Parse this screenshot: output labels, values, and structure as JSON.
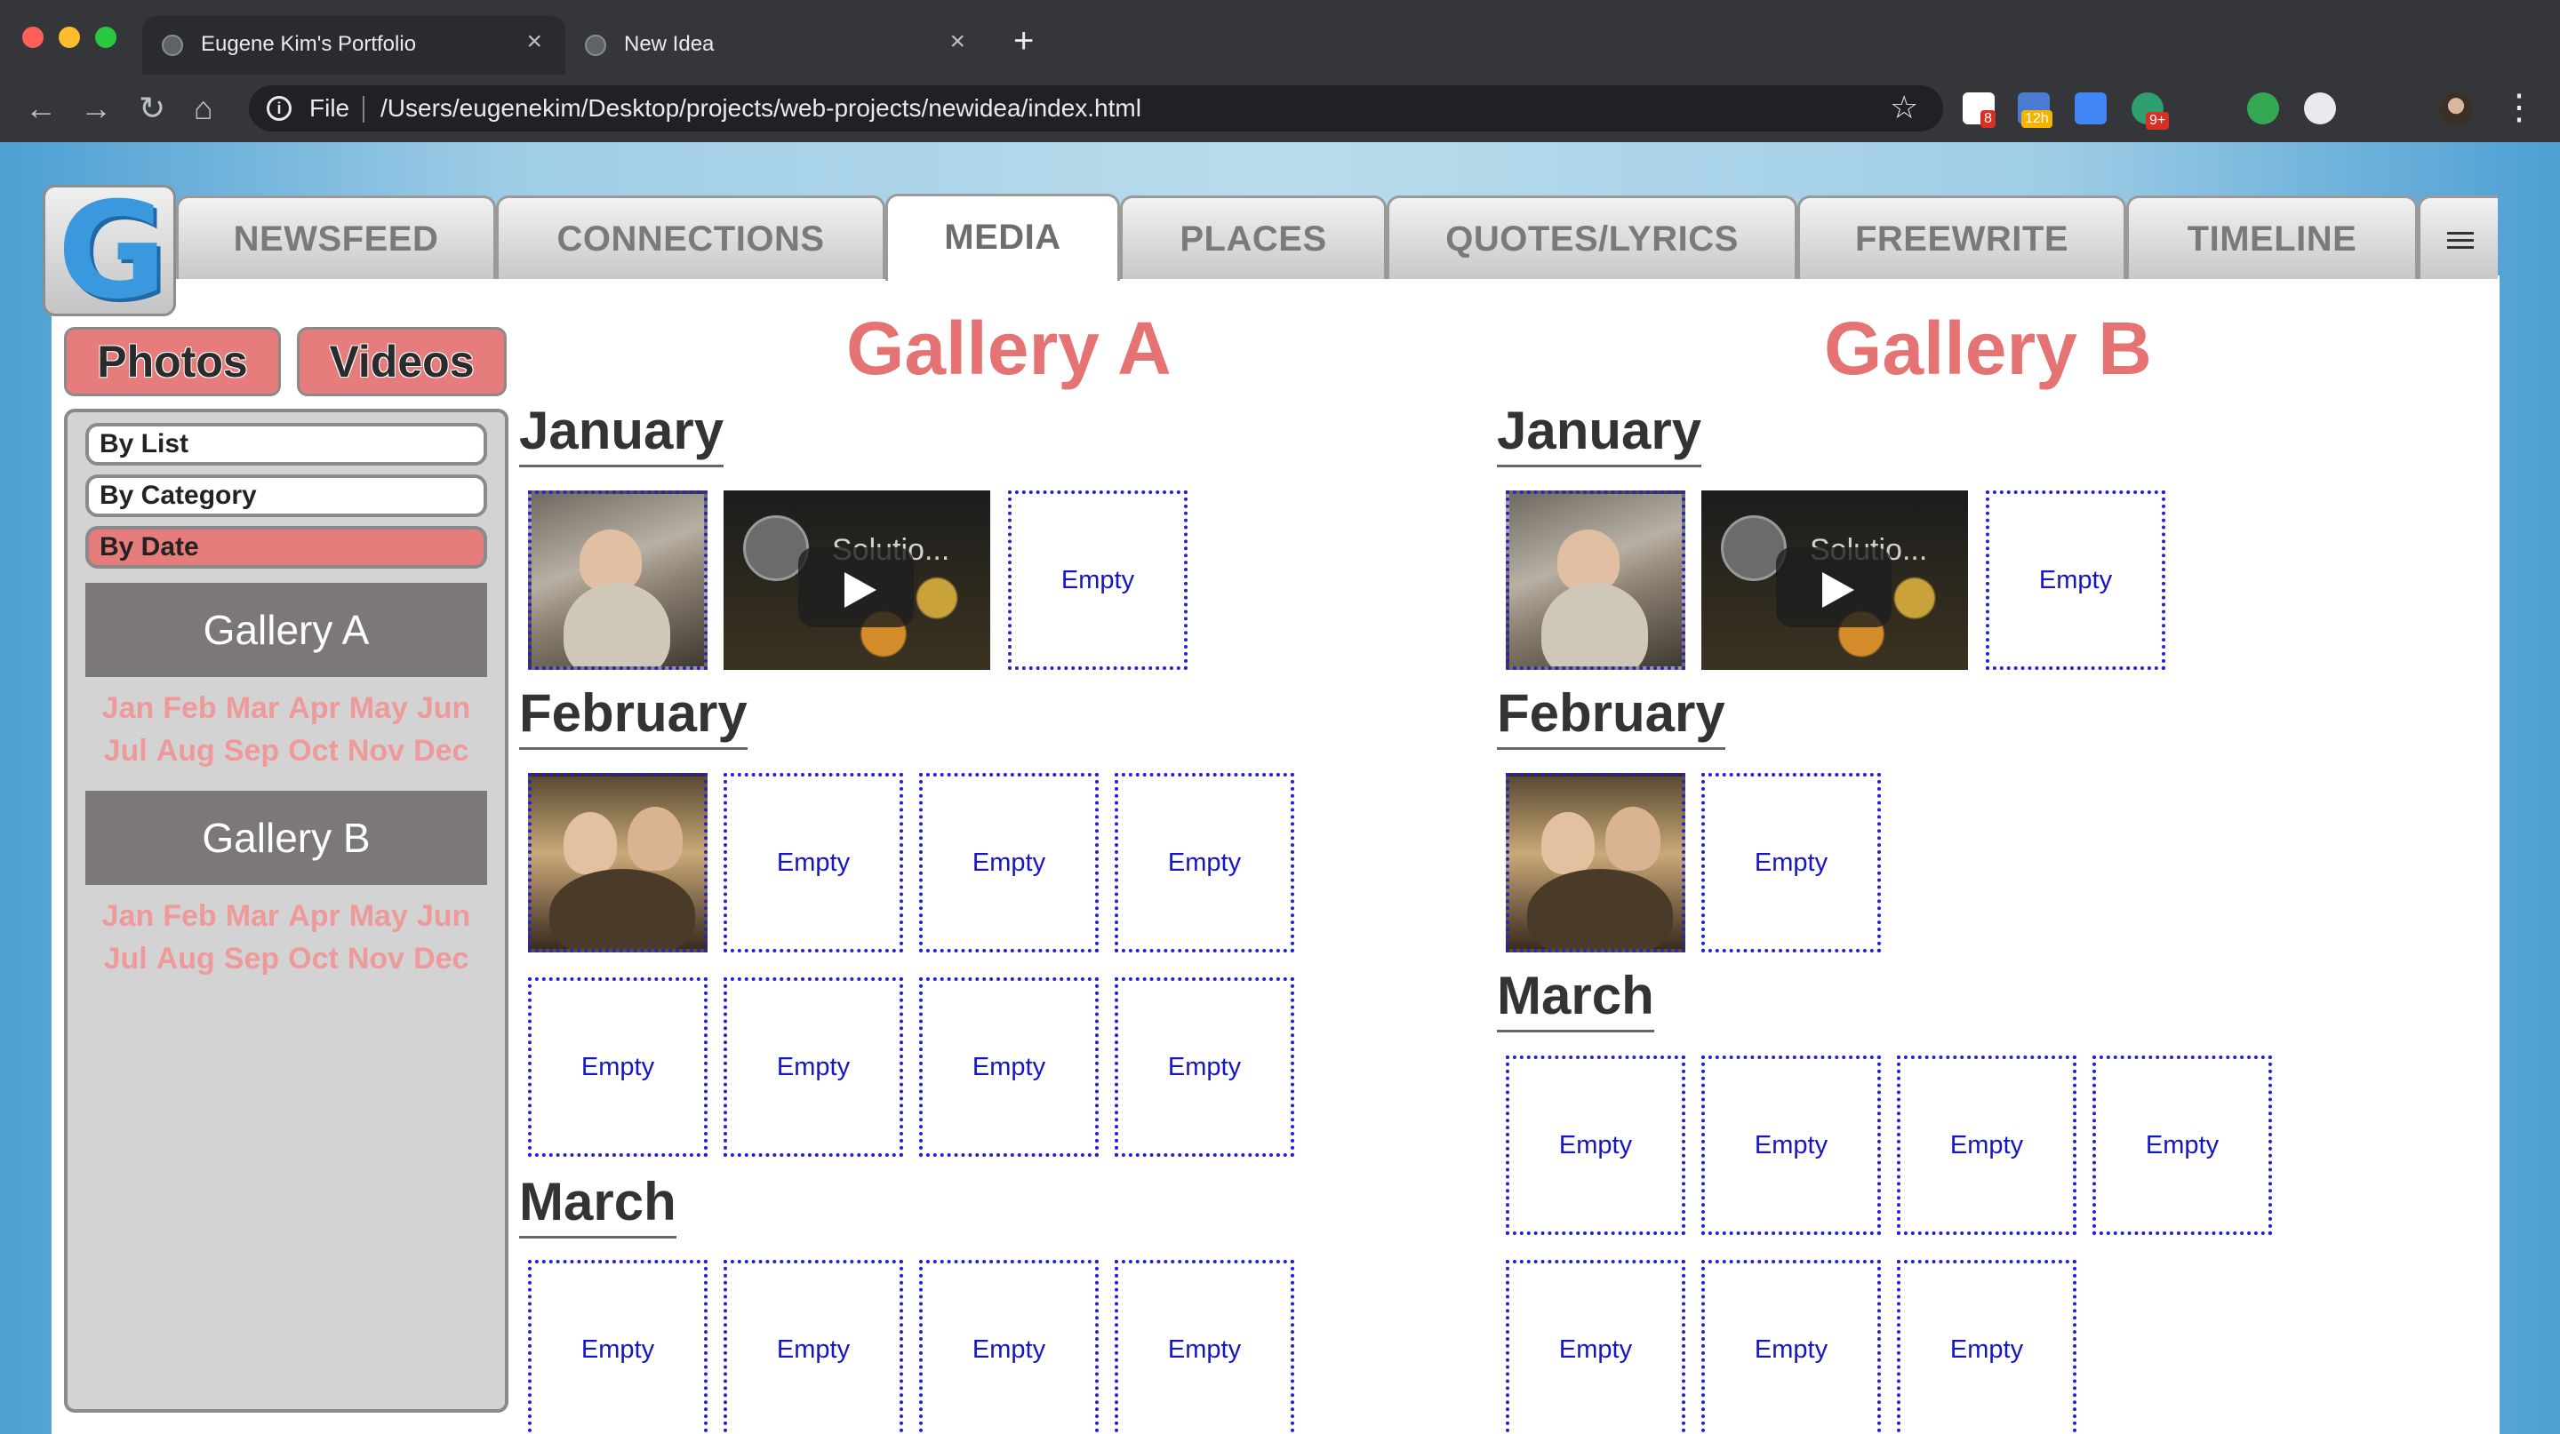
{
  "browser": {
    "tabs": [
      {
        "title": "Eugene Kim's Portfolio",
        "active": false
      },
      {
        "title": "New Idea",
        "active": true
      }
    ],
    "new_tab": "+",
    "close_glyph": "×",
    "scheme": "File",
    "url": "/Users/eugenekim/Desktop/projects/web-projects/newidea/index.html",
    "icons": {
      "back": "←",
      "forward": "→",
      "reload": "↻",
      "home": "⌂",
      "star": "☆",
      "menu": "⋮",
      "info": "i"
    },
    "extension_badges": [
      "8",
      "12h",
      "9+"
    ]
  },
  "app": {
    "logo": "G",
    "nav_tabs": [
      "NEWSFEED",
      "CONNECTIONS",
      "MEDIA",
      "PLACES",
      "QUOTES/LYRICS",
      "FREEWRITE",
      "TIMELINE"
    ],
    "active_tab": "MEDIA",
    "media_buttons": [
      "Photos",
      "Videos"
    ],
    "sort_options": [
      "By List",
      "By Category",
      "By Date"
    ],
    "selected_sort": "By Date",
    "sidebar_galleries": [
      {
        "name": "Gallery A",
        "months_row1": [
          "Jan",
          "Feb",
          "Mar",
          "Apr",
          "May",
          "Jun"
        ],
        "months_row2": [
          "Jul",
          "Aug",
          "Sep",
          "Oct",
          "Nov",
          "Dec"
        ]
      },
      {
        "name": "Gallery B",
        "months_row1": [
          "Jan",
          "Feb",
          "Mar",
          "Apr",
          "May",
          "Jun"
        ],
        "months_row2": [
          "Jul",
          "Aug",
          "Sep",
          "Oct",
          "Nov",
          "Dec"
        ]
      }
    ],
    "galleries": [
      {
        "title": "Gallery A",
        "months": [
          {
            "name": "January",
            "items": [
              "photo",
              "video",
              "Empty"
            ]
          },
          {
            "name": "February",
            "items": [
              "photo",
              "Empty",
              "Empty",
              "Empty",
              "Empty",
              "Empty",
              "Empty",
              "Empty"
            ]
          },
          {
            "name": "March",
            "items": [
              "Empty",
              "Empty",
              "Empty",
              "Empty"
            ]
          }
        ]
      },
      {
        "title": "Gallery B",
        "months": [
          {
            "name": "January",
            "items": [
              "photo",
              "video",
              "Empty"
            ]
          },
          {
            "name": "February",
            "items": [
              "photo",
              "Empty"
            ]
          },
          {
            "name": "March",
            "items": [
              "Empty",
              "Empty",
              "Empty",
              "Empty",
              "Empty",
              "Empty",
              "Empty"
            ]
          }
        ]
      }
    ],
    "video_title": "Solutio...",
    "empty_label": "Empty",
    "colors": {
      "accent": "#e67c7c",
      "title": "#e57373",
      "cell_border": "#2323c8",
      "gallery_header": "#7c7778"
    }
  }
}
